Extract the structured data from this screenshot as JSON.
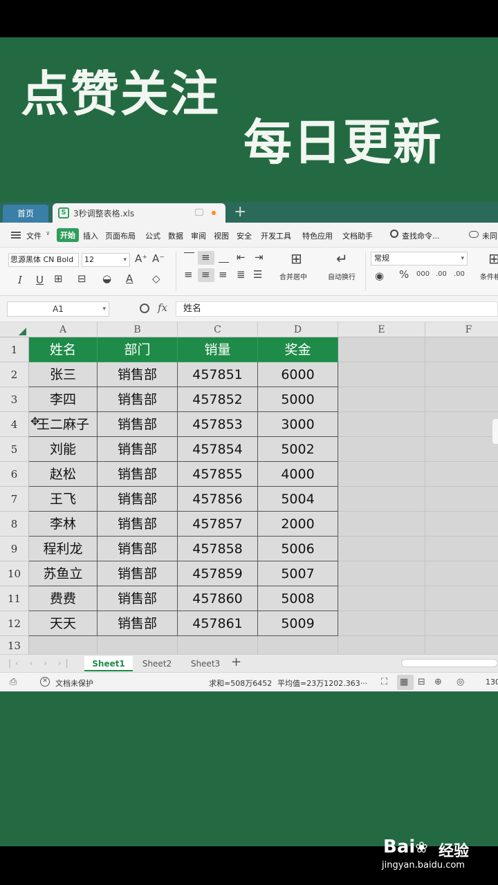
{
  "overlay": {
    "headline_1": "点赞关注",
    "headline_2": "每日更新"
  },
  "tabs": {
    "home": "首页",
    "doc": "3秒调整表格.xls",
    "add": "+"
  },
  "menu": {
    "items": [
      "文件",
      "开始",
      "插入",
      "页面布局",
      "公式",
      "数据",
      "审阅",
      "视图",
      "安全",
      "开发工具",
      "特色应用",
      "文档助手"
    ],
    "search": "查找命令...",
    "cloud": "未同"
  },
  "ribbon": {
    "font_name": "思源黑体 CN Bold",
    "font_size": "12",
    "merge_label": "合并居中",
    "wrap_label": "自动换行",
    "number_format": "常规",
    "cond_label": "条件格"
  },
  "formula": {
    "cell_ref": "A1",
    "fx": "fx",
    "content": "姓名"
  },
  "sheet": {
    "columns": [
      "A",
      "B",
      "C",
      "D",
      "E",
      "F"
    ],
    "row_numbers": [
      "1",
      "2",
      "3",
      "4",
      "5",
      "6",
      "7",
      "8",
      "9",
      "10",
      "11",
      "12",
      "13"
    ],
    "header": [
      "姓名",
      "部门",
      "销量",
      "奖金"
    ],
    "rows": [
      [
        "张三",
        "销售部",
        "457851",
        "6000"
      ],
      [
        "李四",
        "销售部",
        "457852",
        "5000"
      ],
      [
        "王二麻子",
        "销售部",
        "457853",
        "3000"
      ],
      [
        "刘能",
        "销售部",
        "457854",
        "5002"
      ],
      [
        "赵松",
        "销售部",
        "457855",
        "4000"
      ],
      [
        "王飞",
        "销售部",
        "457856",
        "5004"
      ],
      [
        "李林",
        "销售部",
        "457857",
        "2000"
      ],
      [
        "程利龙",
        "销售部",
        "457858",
        "5006"
      ],
      [
        "苏鱼立",
        "销售部",
        "457859",
        "5007"
      ],
      [
        "费费",
        "销售部",
        "457860",
        "5008"
      ],
      [
        "天天",
        "销售部",
        "457861",
        "5009"
      ]
    ],
    "sheet_tabs": [
      "Sheet1",
      "Sheet2",
      "Sheet3"
    ]
  },
  "status": {
    "protect": "文档未保护",
    "sum": "求和=508万6452",
    "avg": "平均值=23万1202.363···",
    "zoom": "130"
  },
  "watermark": {
    "logo": "Bai",
    "logo_suffix": "经验",
    "url": "jingyan.baidu.com"
  },
  "colors": {
    "background_green": "#236a42",
    "header_fill": "#1f8b49",
    "accent": "#2e9e5b"
  }
}
